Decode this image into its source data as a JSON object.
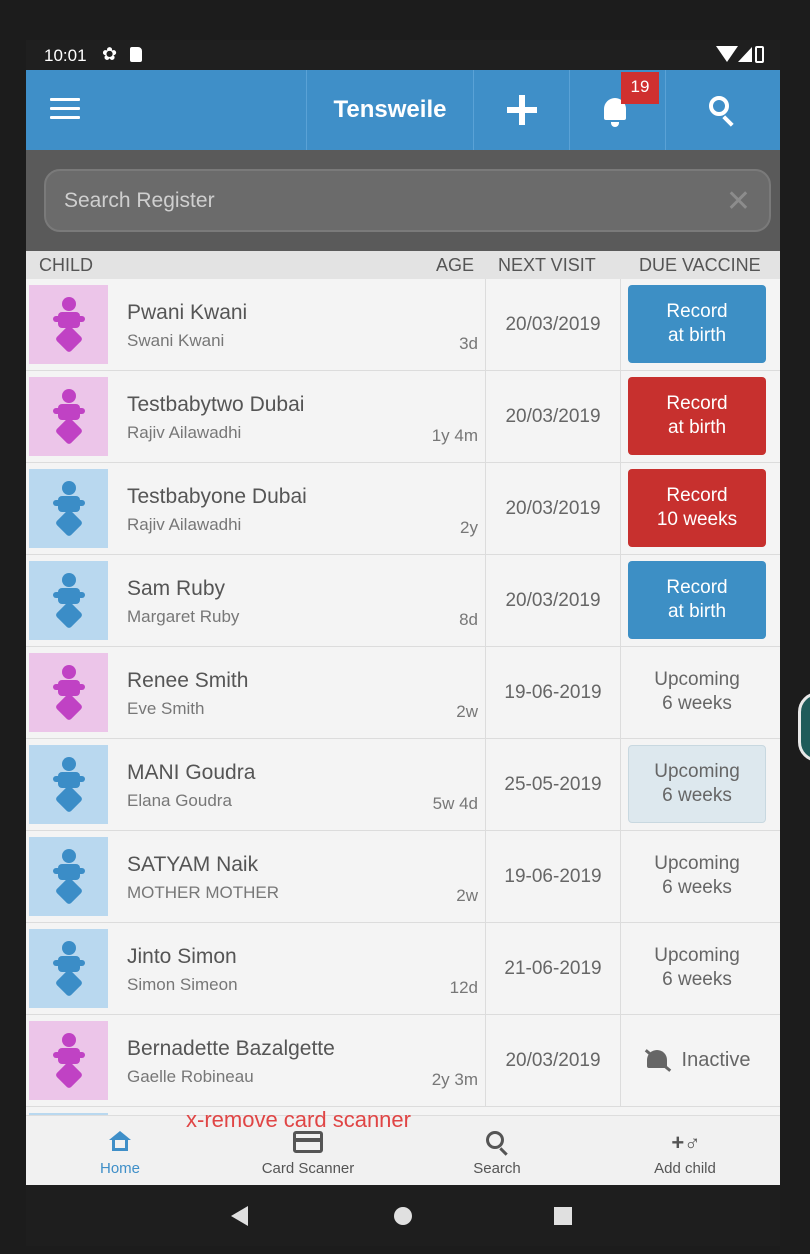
{
  "status_bar": {
    "time": "10:01"
  },
  "app_bar": {
    "title": "Tensweile",
    "notification_count": "19"
  },
  "search": {
    "placeholder": "Search Register"
  },
  "columns": {
    "child": "CHILD",
    "age": "AGE",
    "next_visit": "NEXT VISIT",
    "due_vaccine": "DUE VACCINE"
  },
  "rows": [
    {
      "name": "Pwani Kwani",
      "parent": "Swani Kwani",
      "age": "3d",
      "next_visit": "20/03/2019",
      "vaccine_line1": "Record",
      "vaccine_line2": "at birth",
      "status": "due",
      "gender": "girl"
    },
    {
      "name": "Testbabytwo Dubai",
      "parent": "Rajiv Ailawadhi",
      "age": "1y 4m",
      "next_visit": "20/03/2019",
      "vaccine_line1": "Record",
      "vaccine_line2": "at birth",
      "status": "overdue",
      "gender": "girl"
    },
    {
      "name": "Testbabyone Dubai",
      "parent": "Rajiv Ailawadhi",
      "age": "2y",
      "next_visit": "20/03/2019",
      "vaccine_line1": "Record",
      "vaccine_line2": "10 weeks",
      "status": "overdue",
      "gender": "boy"
    },
    {
      "name": "Sam Ruby",
      "parent": "Margaret Ruby",
      "age": "8d",
      "next_visit": "20/03/2019",
      "vaccine_line1": "Record",
      "vaccine_line2": "at birth",
      "status": "due",
      "gender": "boy"
    },
    {
      "name": "Renee Smith",
      "parent": "Eve Smith",
      "age": "2w",
      "next_visit": "19-06-2019",
      "vaccine_line1": "Upcoming",
      "vaccine_line2": "6 weeks",
      "status": "upcoming",
      "gender": "girl"
    },
    {
      "name": "MANI Goudra",
      "parent": "Elana Goudra",
      "age": "5w 4d",
      "next_visit": "25-05-2019",
      "vaccine_line1": "Upcoming",
      "vaccine_line2": "6 weeks",
      "status": "upcoming-box",
      "gender": "boy"
    },
    {
      "name": "SATYAM Naik",
      "parent": "MOTHER MOTHER",
      "age": "2w",
      "next_visit": "19-06-2019",
      "vaccine_line1": "Upcoming",
      "vaccine_line2": "6 weeks",
      "status": "upcoming",
      "gender": "boy"
    },
    {
      "name": "Jinto Simon",
      "parent": "Simon Simeon",
      "age": "12d",
      "next_visit": "21-06-2019",
      "vaccine_line1": "Upcoming",
      "vaccine_line2": "6 weeks",
      "status": "upcoming",
      "gender": "boy"
    },
    {
      "name": "Bernadette Bazalgette",
      "parent": "Gaelle Robineau",
      "age": "2y 3m",
      "next_visit": "20/03/2019",
      "vaccine_line1": "Inactive",
      "vaccine_line2": "",
      "status": "inactive",
      "gender": "girl"
    }
  ],
  "bottom_nav": {
    "items": [
      {
        "label": "Home",
        "icon": "home-icon",
        "active": true
      },
      {
        "label": "Card Scanner",
        "icon": "card-icon",
        "active": false
      },
      {
        "label": "Search",
        "icon": "search-icon",
        "active": false
      },
      {
        "label": "Add child",
        "icon": "add-child-icon",
        "active": false
      }
    ],
    "dev_note": "x-remove card scanner"
  },
  "colors": {
    "primary": "#3f8fc8",
    "overdue": "#c7302e",
    "girl_bg": "#ecc5e9",
    "boy_bg": "#b9d8ef"
  }
}
